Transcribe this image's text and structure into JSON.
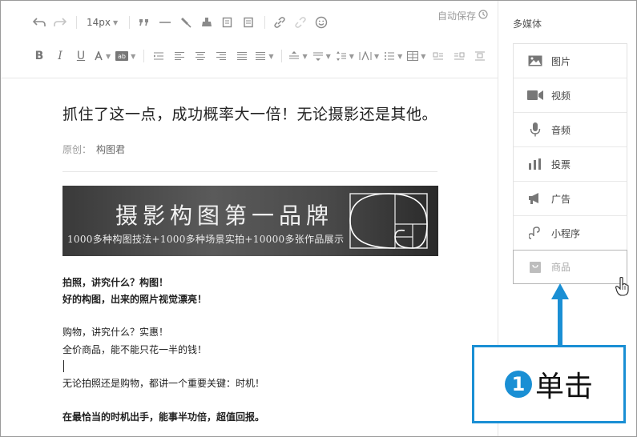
{
  "toolbar": {
    "font_size": "14px",
    "autosave_label": "自动保存"
  },
  "article": {
    "title": "抓住了这一点，成功概率大一倍！无论摄影还是其他。",
    "author_label": "原创：",
    "author_name": "构图君",
    "banner_title": "摄影构图第一品牌",
    "banner_subtitle": "1000多种构图技法+1000多种场景实拍+10000多张作品展示",
    "paragraphs": [
      "拍照，讲究什么？构图！",
      "好的构图，出来的照片视觉漂亮！",
      "购物，讲究什么？实惠！",
      "全价商品，能不能只花一半的钱！",
      "无论拍照还是购物，都讲一个重要关键：时机！",
      "在最恰当的时机出手，能事半功倍，超值回报。"
    ]
  },
  "media_panel": {
    "title": "多媒体",
    "items": [
      {
        "label": "图片",
        "icon": "image-icon"
      },
      {
        "label": "视频",
        "icon": "video-icon"
      },
      {
        "label": "音频",
        "icon": "microphone-icon"
      },
      {
        "label": "投票",
        "icon": "bar-chart-icon"
      },
      {
        "label": "广告",
        "icon": "megaphone-icon"
      },
      {
        "label": "小程序",
        "icon": "mini-program-icon"
      },
      {
        "label": "商品",
        "icon": "bag-icon"
      }
    ]
  },
  "callout": {
    "step": "1",
    "text": "单击",
    "color": "#1a8fd4"
  }
}
